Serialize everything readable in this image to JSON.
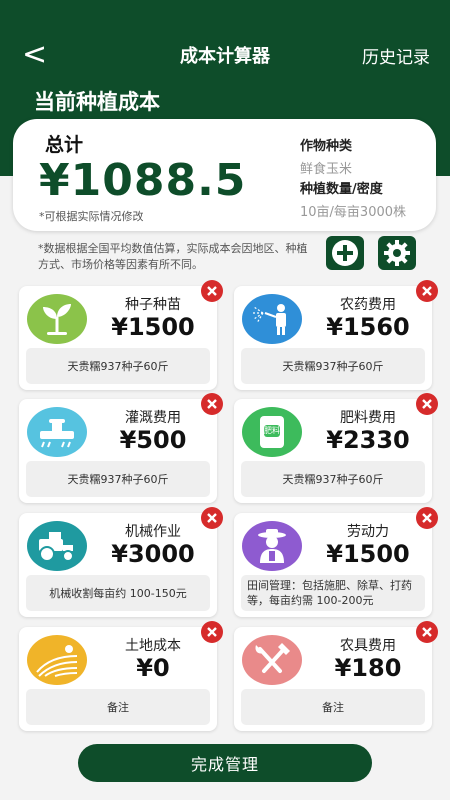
{
  "topbar": {
    "back_symbol": "<",
    "title": "成本计算器",
    "history_label": "历史记录"
  },
  "section_title": "当前种植成本",
  "summary": {
    "total_label": "总计",
    "total_value": "¥1088.5",
    "note": "*可根据实际情况修改",
    "crop_label": "作物种类",
    "crop_value": "鲜食玉米",
    "quantity_label": "种植数量/密度",
    "quantity_value": "10亩/每亩3000株"
  },
  "disclaimer": "*数据根据全国平均数值估算，实际成本会因地区、种植方式、市场价格等因素有所不同。",
  "colors": {
    "primary": "#0e4d2a",
    "delete": "#d62b2b"
  },
  "cards": [
    {
      "title": "种子种苗",
      "value": "¥1500",
      "note": "天贵糯937种子60斤",
      "icon": "seedling-icon",
      "icon_color": "#8bc34a"
    },
    {
      "title": "农药费用",
      "value": "¥1560",
      "note": "天贵糯937种子60斤",
      "icon": "sprayer-icon",
      "icon_color": "#2f8fd8"
    },
    {
      "title": "灌溉费用",
      "value": "¥500",
      "note": "天贵糯937种子60斤",
      "icon": "irrigation-icon",
      "icon_color": "#56c3e0"
    },
    {
      "title": "肥料费用",
      "value": "¥2330",
      "note": "天贵糯937种子60斤",
      "icon": "fertilizer-icon",
      "icon_color": "#3dbb5c",
      "icon_text": "肥料"
    },
    {
      "title": "机械作业",
      "value": "¥3000",
      "note": "机械收割每亩约 100-150元",
      "icon": "tractor-icon",
      "icon_color": "#1f9aa0"
    },
    {
      "title": "劳动力",
      "value": "¥1500",
      "note": "田间管理：包括施肥、除草、打药等，每亩约需 100-200元",
      "icon": "farmer-icon",
      "icon_color": "#8e5bd0"
    },
    {
      "title": "土地成本",
      "value": "¥0",
      "note": "备注",
      "icon": "field-icon",
      "icon_color": "#f0b429"
    },
    {
      "title": "农具费用",
      "value": "¥180",
      "note": "备注",
      "icon": "tools-icon",
      "icon_color": "#e98a8a"
    }
  ],
  "complete_label": "完成管理"
}
